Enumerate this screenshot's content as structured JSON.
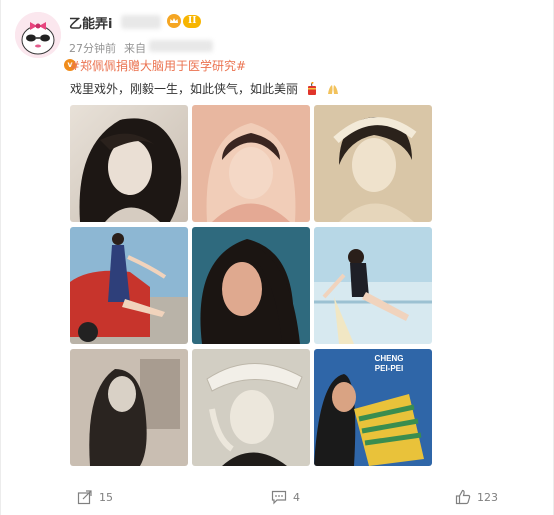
{
  "post": {
    "username": "乙能弄i",
    "level_badge": "II",
    "vip_badge": "v",
    "time": "27分钟前",
    "source": "来自",
    "topic": "#郑佩佩捐赠大脑用于医学研究#",
    "text": "戏里戏外，刚毅一生，如此侠气，如此美丽",
    "emojis": [
      "fire-cracker-icon",
      "hands-icon"
    ]
  },
  "photos": [
    {
      "name": "photo-1",
      "palette": [
        "#d9cfc4",
        "#1d1714",
        "#eadfd4"
      ]
    },
    {
      "name": "photo-2",
      "palette": [
        "#e5b49c",
        "#3a2520",
        "#f4d8c6"
      ]
    },
    {
      "name": "photo-3",
      "palette": [
        "#d6c2a2",
        "#2b221b",
        "#efe2cc"
      ]
    },
    {
      "name": "photo-4",
      "palette": [
        "#7aa9c9",
        "#c7342c",
        "#2e3f7a"
      ]
    },
    {
      "name": "photo-5",
      "palette": [
        "#2f6a7e",
        "#1b1512",
        "#dfa98f"
      ]
    },
    {
      "name": "photo-6",
      "palette": [
        "#9fc5d6",
        "#d7e9f0",
        "#1e1f26"
      ]
    },
    {
      "name": "photo-7",
      "palette": [
        "#b7ab9e",
        "#2a2420",
        "#d9d1c6"
      ]
    },
    {
      "name": "photo-8",
      "palette": [
        "#c9c4b8",
        "#1f1c19",
        "#ece7dc"
      ]
    },
    {
      "name": "photo-9",
      "palette": [
        "#2f66a8",
        "#e9c23a",
        "#1a1a1a"
      ]
    }
  ],
  "photo_captions": {
    "photo_9_line1": "CHENG",
    "photo_9_line2": "PEI-PEI"
  },
  "actions": {
    "share_count": "15",
    "comment_count": "4",
    "like_count": "123"
  },
  "colors": {
    "topic": "#eb7350",
    "muted": "#939393",
    "level_badge": "#f7b500"
  }
}
